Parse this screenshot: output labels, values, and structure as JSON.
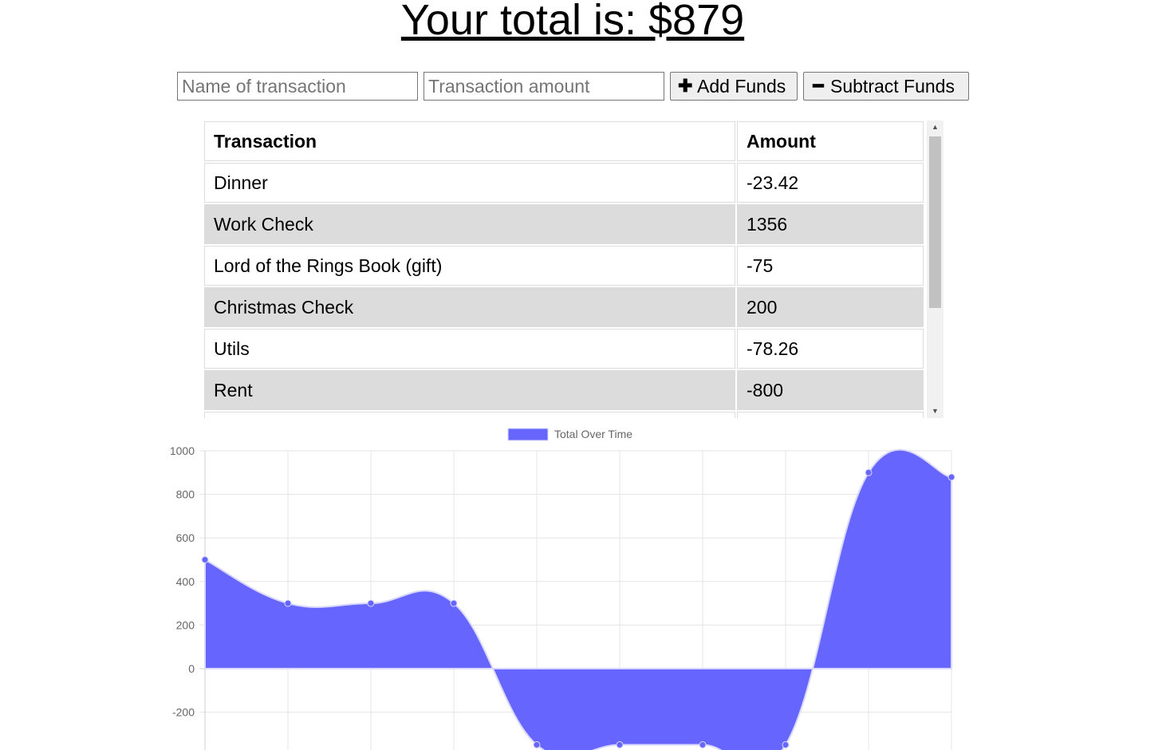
{
  "header": {
    "total_text": "Your total is: $879"
  },
  "form": {
    "name_placeholder": "Name of transaction",
    "amount_placeholder": "Transaction amount",
    "add_label": "Add Funds",
    "subtract_label": "Subtract Funds"
  },
  "table": {
    "headers": [
      "Transaction",
      "Amount"
    ],
    "rows": [
      {
        "name": "Dinner",
        "amount": "-23.42"
      },
      {
        "name": "Work Check",
        "amount": "1356"
      },
      {
        "name": "Lord of the Rings Book (gift)",
        "amount": "-75"
      },
      {
        "name": "Christmas Check",
        "amount": "200"
      },
      {
        "name": "Utils",
        "amount": "-78.26"
      },
      {
        "name": "Rent",
        "amount": "-800"
      },
      {
        "name": "",
        "amount": ""
      }
    ]
  },
  "colors": {
    "fill": "#6666ff",
    "stroke": "#d9d9ff",
    "grid": "#e5e5e5",
    "tick": "#666666"
  },
  "chart_data": {
    "type": "area",
    "series": [
      {
        "name": "Total Over Time",
        "values": [
          500,
          300,
          300,
          300,
          -350,
          -350,
          -350,
          -350,
          900,
          879
        ]
      }
    ],
    "ylim": [
      -400,
      1000
    ],
    "yticks": [
      1000,
      800,
      600,
      400,
      200,
      0,
      -200
    ],
    "grid": true,
    "legend": "top-center"
  }
}
